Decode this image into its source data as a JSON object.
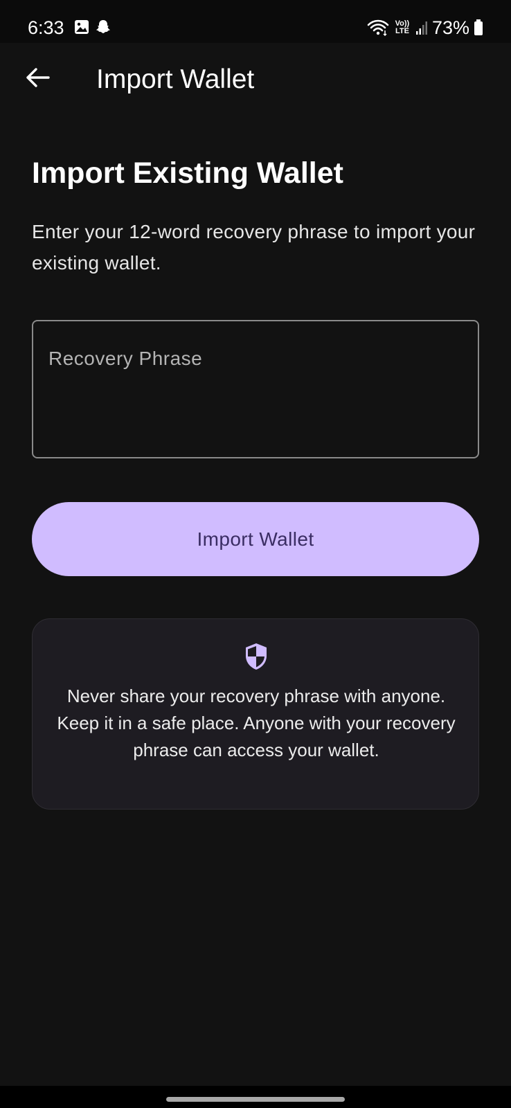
{
  "status_bar": {
    "time": "6:33",
    "network_label": "Vo)) LTE",
    "battery_percent": "73%",
    "icons": [
      "gallery-icon",
      "snapchat-icon",
      "wifi-icon",
      "signal-icon",
      "battery-icon"
    ]
  },
  "app_bar": {
    "back_icon": "arrow-left-icon",
    "title": "Import Wallet"
  },
  "main": {
    "heading": "Import Existing Wallet",
    "description": "Enter your 12-word recovery phrase to import your existing wallet.",
    "recovery_field": {
      "placeholder": "Recovery Phrase",
      "value": ""
    },
    "import_button_label": "Import Wallet",
    "warning": {
      "icon": "shield-icon",
      "text": "Never share your recovery phrase with anyone. Keep it in a safe place. Anyone with your recovery phrase can access your wallet."
    }
  },
  "colors": {
    "background": "#121212",
    "accent": "#d0bcff",
    "accent_text": "#3a2d63",
    "card_background": "#1e1c22"
  }
}
